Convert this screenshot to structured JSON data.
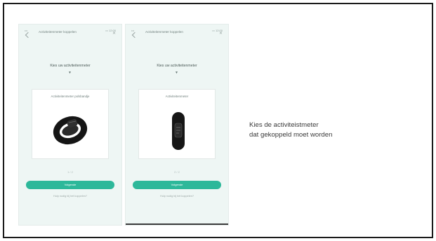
{
  "screens": [
    {
      "status_carrier": "•••",
      "status_battery": "▭ 12:00",
      "title": "Activiteitenmeter koppelen",
      "heading": "Kies uw activiteitenmeter",
      "device_label": "Activiteitenmeter polsbandje",
      "pager": "1 / 2",
      "button_label": "Volgende",
      "help_text": "Hulp nodig bij het koppelen?"
    },
    {
      "status_carrier": "•••",
      "status_battery": "▭ 12:00",
      "title": "Activiteitenmeter koppelen",
      "heading": "Kies uw activiteitenmeter",
      "device_label": "Activiteitenmeter",
      "pager": "2 / 2",
      "button_label": "Volgende",
      "help_text": "Hulp nodig bij het koppelen?"
    }
  ],
  "description": {
    "line1": "Kies de activiteistmeter",
    "line2": "dat gekoppeld moet worden"
  },
  "colors": {
    "accent": "#2db89a",
    "screen_bg": "#eef6f4",
    "frame_border": "#1a1a1a"
  },
  "icons": [
    "back-icon",
    "close-icon",
    "chevron-down-icon",
    "wristband-device-icon",
    "fitness-tracker-device-icon"
  ]
}
